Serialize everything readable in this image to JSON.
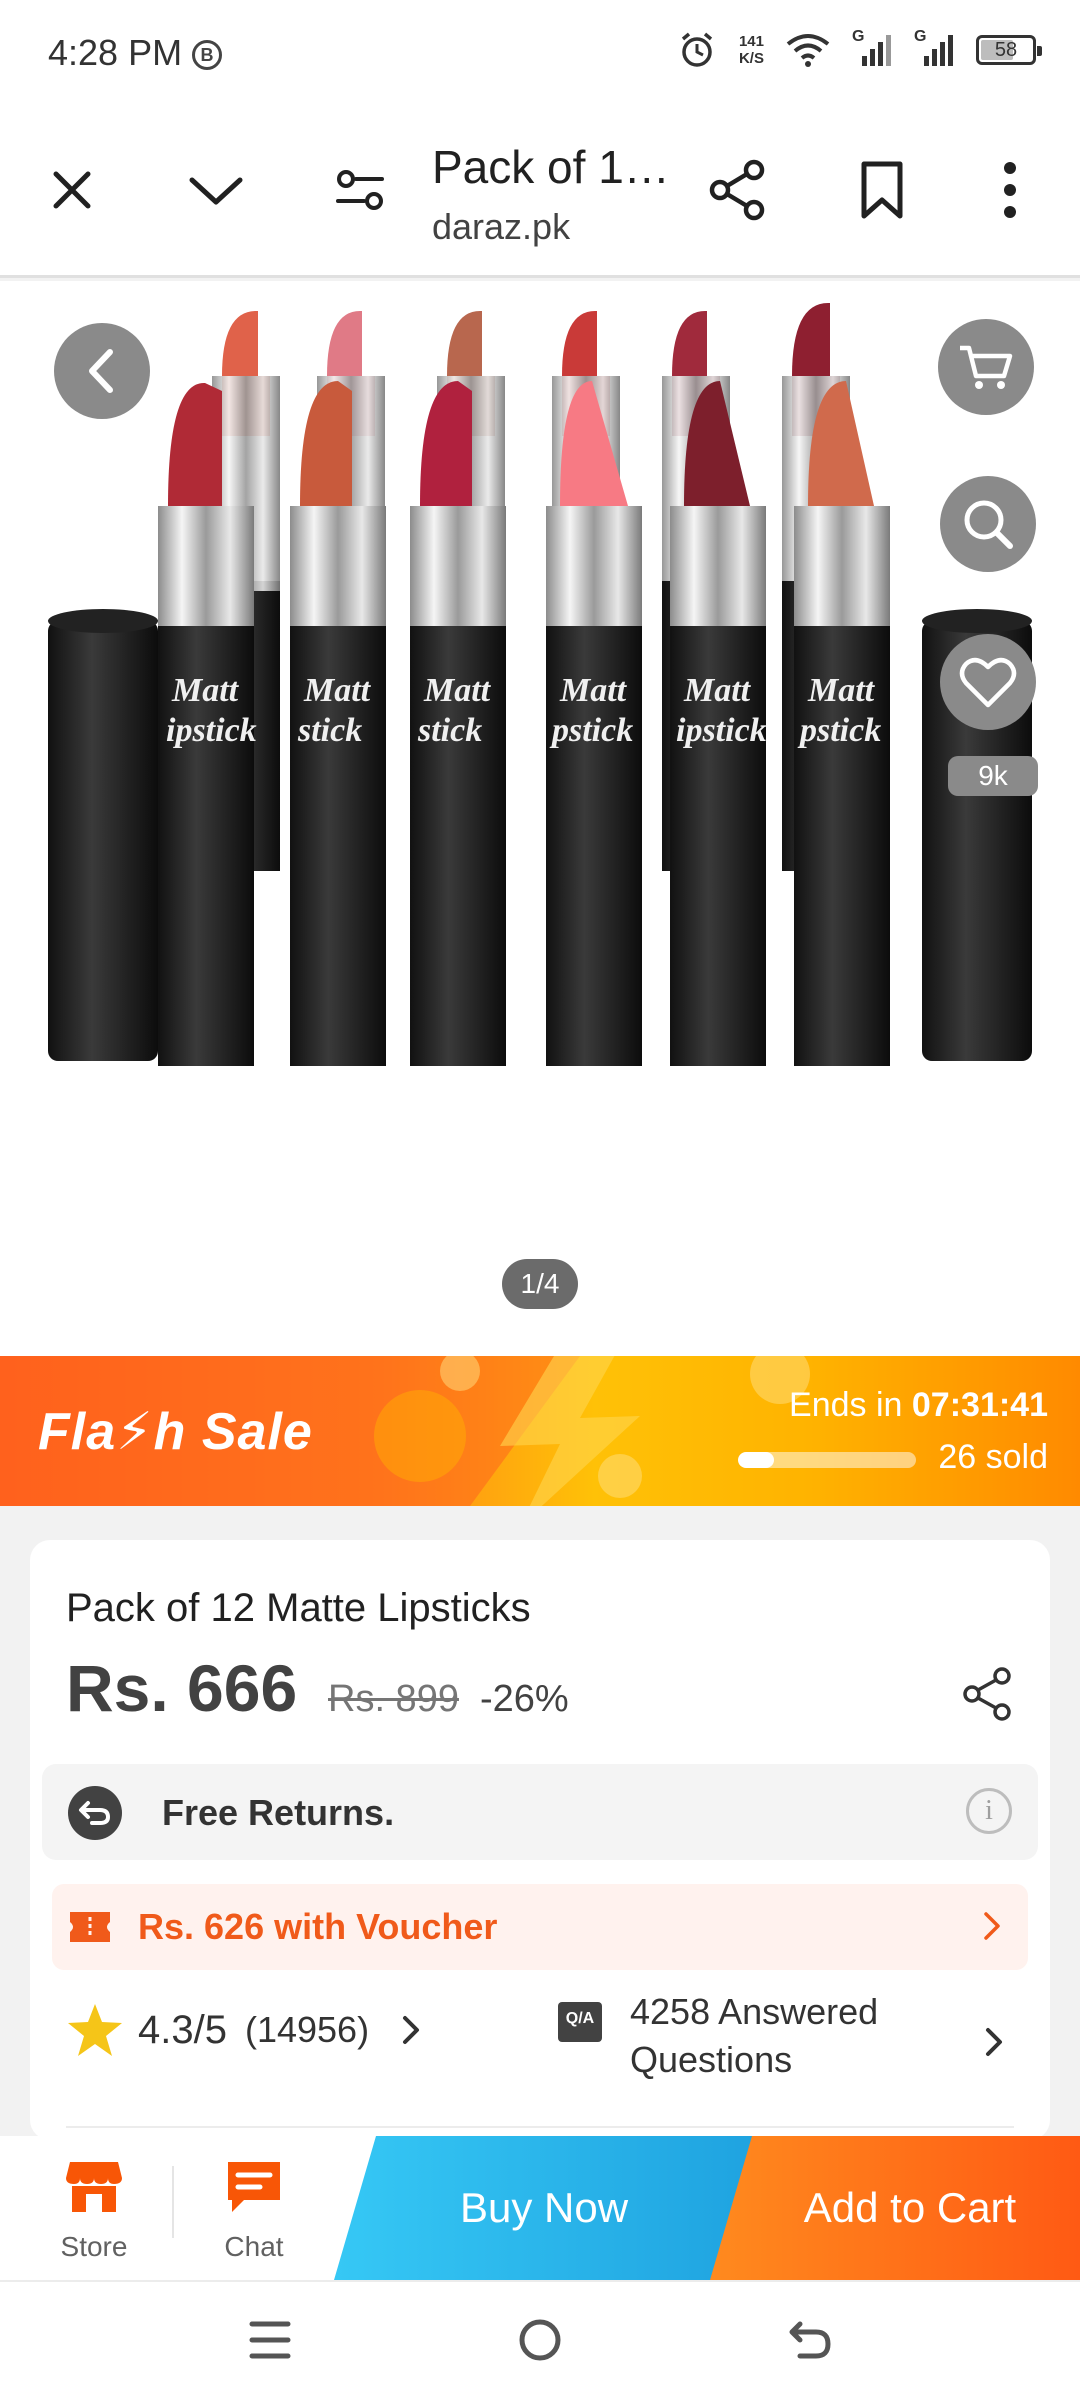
{
  "status_bar": {
    "time": "4:28 PM",
    "b_badge": "B",
    "net_speed_top": "141",
    "net_speed_bottom": "K/S",
    "sim1": "G",
    "sim2": "G",
    "battery": "58"
  },
  "toolbar": {
    "page_title": "Pack of 1…",
    "url": "daraz.pk"
  },
  "gallery": {
    "likes": "9k",
    "page_indicator": "1/4",
    "product_image_labels": [
      "Matt",
      "Lipstick"
    ]
  },
  "flash_sale": {
    "title": "Fla⚡h  Sale",
    "ends_label": "Ends in",
    "countdown": "07:31:41",
    "sold": "26 sold",
    "sold_progress": 0.2
  },
  "product": {
    "title": "Pack of 12 Matte Lipsticks",
    "price": "Rs. 666",
    "original_price": "Rs. 899",
    "discount": "-26%",
    "returns": "Free Returns.",
    "info_icon": "i",
    "voucher": "Rs. 626 with Voucher",
    "rating": "4.3/5",
    "rating_count": "(14956)",
    "qa_badge": "Q/A",
    "qa": "4258 Answered Questions"
  },
  "bottom_bar": {
    "store": "Store",
    "chat": "Chat",
    "buy_now": "Buy Now",
    "add_to_cart": "Add to Cart"
  },
  "colors": {
    "brand_orange": "#f85606",
    "voucher_text": "#f05a1a",
    "buy_now": "#1fa3e0",
    "star": "#f5c518"
  }
}
